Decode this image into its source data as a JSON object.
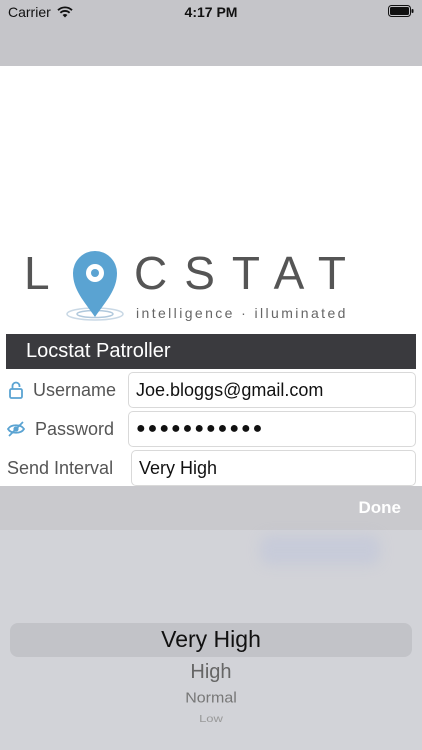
{
  "status_bar": {
    "carrier": "Carrier",
    "time": "4:17 PM"
  },
  "logo": {
    "wordmark": "LOCSTAT",
    "tagline": "intelligence · illuminated",
    "accent_color": "#5aa3d2"
  },
  "app_title": "Locstat Patroller",
  "form": {
    "username": {
      "label": "Username",
      "value": "Joe.bloggs@gmail.com",
      "icon": "lock-icon"
    },
    "password": {
      "label": "Password",
      "value": "●●●●●●●●●●●",
      "icon": "eye-off-icon"
    },
    "send_interval": {
      "label": "Send Interval",
      "value": "Very High"
    }
  },
  "toolbar": {
    "done_label": "Done"
  },
  "picker": {
    "selected": "Very High",
    "options": [
      "Very High",
      "High",
      "Normal",
      "Low"
    ]
  }
}
